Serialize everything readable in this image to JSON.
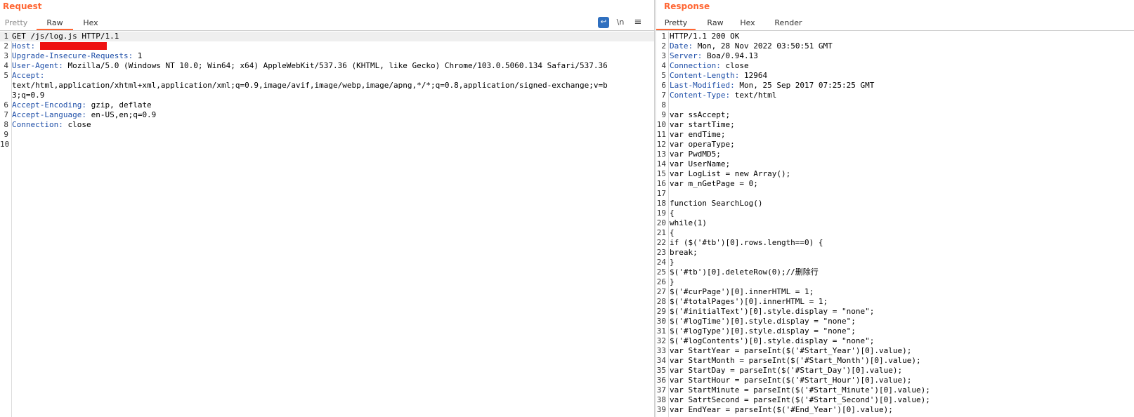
{
  "request": {
    "title": "Request",
    "tabs": [
      "Pretty",
      "Raw",
      "Hex"
    ],
    "active_tab": "Raw",
    "toolbar": {
      "wrap_icon_glyph": "↩",
      "newline_label": "\\n",
      "menu_glyph": "≡"
    },
    "lines": [
      {
        "n": "1",
        "key": "",
        "val": "GET /js/log.js HTTP/1.1"
      },
      {
        "n": "2",
        "key": "Host:",
        "val": ""
      },
      {
        "n": "3",
        "key": "Upgrade-Insecure-Requests:",
        "val": " 1"
      },
      {
        "n": "4",
        "key": "User-Agent:",
        "val": " Mozilla/5.0 (Windows NT 10.0; Win64; x64) AppleWebKit/537.36 (KHTML, like Gecko) Chrome/103.0.5060.134 Safari/537.36"
      },
      {
        "n": "5",
        "key": "Accept:",
        "val": ""
      },
      {
        "n": "",
        "key": "",
        "val": "text/html,application/xhtml+xml,application/xml;q=0.9,image/avif,image/webp,image/apng,*/*;q=0.8,application/signed-exchange;v=b"
      },
      {
        "n": "",
        "key": "",
        "val": "3;q=0.9"
      },
      {
        "n": "6",
        "key": "Accept-Encoding:",
        "val": " gzip, deflate"
      },
      {
        "n": "7",
        "key": "Accept-Language:",
        "val": " en-US,en;q=0.9"
      },
      {
        "n": "8",
        "key": "Connection:",
        "val": " close"
      },
      {
        "n": "9",
        "key": "",
        "val": ""
      },
      {
        "n": "10",
        "key": "",
        "val": ""
      }
    ]
  },
  "response": {
    "title": "Response",
    "tabs": [
      "Pretty",
      "Raw",
      "Hex",
      "Render"
    ],
    "active_tab": "Pretty",
    "lines": [
      {
        "n": "1",
        "key": "",
        "val": "HTTP/1.1 200 OK"
      },
      {
        "n": "2",
        "key": "Date:",
        "val": " Mon, 28 Nov 2022 03:50:51 GMT"
      },
      {
        "n": "3",
        "key": "Server:",
        "val": " Boa/0.94.13"
      },
      {
        "n": "4",
        "key": "Connection:",
        "val": " close"
      },
      {
        "n": "5",
        "key": "Content-Length:",
        "val": " 12964"
      },
      {
        "n": "6",
        "key": "Last-Modified:",
        "val": " Mon, 25 Sep 2017 07:25:25 GMT"
      },
      {
        "n": "7",
        "key": "Content-Type:",
        "val": " text/html"
      },
      {
        "n": "8",
        "key": "",
        "val": ""
      },
      {
        "n": "9",
        "key": "",
        "val": "var ssAccept;"
      },
      {
        "n": "10",
        "key": "",
        "val": "var startTime;"
      },
      {
        "n": "11",
        "key": "",
        "val": "var endTime;"
      },
      {
        "n": "12",
        "key": "",
        "val": "var operaType;"
      },
      {
        "n": "13",
        "key": "",
        "val": "var PwdMD5;"
      },
      {
        "n": "14",
        "key": "",
        "val": "var UserName;"
      },
      {
        "n": "15",
        "key": "",
        "val": "var LogList = new Array();"
      },
      {
        "n": "16",
        "key": "",
        "val": "var m_nGetPage = 0;"
      },
      {
        "n": "17",
        "key": "",
        "val": ""
      },
      {
        "n": "18",
        "key": "",
        "val": "function SearchLog()"
      },
      {
        "n": "19",
        "key": "",
        "val": "{"
      },
      {
        "n": "20",
        "key": "",
        "val": "while(1)"
      },
      {
        "n": "21",
        "key": "",
        "val": "{"
      },
      {
        "n": "22",
        "key": "",
        "val": "if ($('#tb')[0].rows.length==0) {"
      },
      {
        "n": "23",
        "key": "",
        "val": "break;"
      },
      {
        "n": "24",
        "key": "",
        "val": "}"
      },
      {
        "n": "25",
        "key": "",
        "val": "$('#tb')[0].deleteRow(0);//删除行"
      },
      {
        "n": "26",
        "key": "",
        "val": "}"
      },
      {
        "n": "27",
        "key": "",
        "val": "$('#curPage')[0].innerHTML = 1;"
      },
      {
        "n": "28",
        "key": "",
        "val": "$('#totalPages')[0].innerHTML = 1;"
      },
      {
        "n": "29",
        "key": "",
        "val": "$('#initialText')[0].style.display = \"none\";"
      },
      {
        "n": "30",
        "key": "",
        "val": "$('#logTime')[0].style.display = \"none\";"
      },
      {
        "n": "31",
        "key": "",
        "val": "$('#logType')[0].style.display = \"none\";"
      },
      {
        "n": "32",
        "key": "",
        "val": "$('#logContents')[0].style.display = \"none\";"
      },
      {
        "n": "33",
        "key": "",
        "val": "var StartYear = parseInt($('#Start_Year')[0].value);"
      },
      {
        "n": "34",
        "key": "",
        "val": "var StartMonth = parseInt($('#Start_Month')[0].value);"
      },
      {
        "n": "35",
        "key": "",
        "val": "var StartDay = parseInt($('#Start_Day')[0].value);"
      },
      {
        "n": "36",
        "key": "",
        "val": "var StartHour = parseInt($('#Start_Hour')[0].value);"
      },
      {
        "n": "37",
        "key": "",
        "val": "var StartMinute = parseInt($('#Start_Minute')[0].value);"
      },
      {
        "n": "38",
        "key": "",
        "val": "var SatrtSecond = parseInt($('#Start_Second')[0].value);"
      },
      {
        "n": "39",
        "key": "",
        "val": "var EndYear = parseInt($('#End_Year')[0].value);"
      }
    ]
  },
  "colors": {
    "accent": "#ff6633",
    "header_key": "#1f4fa8",
    "redaction": "#ee1111",
    "wrap_button": "#2f6fbf"
  }
}
